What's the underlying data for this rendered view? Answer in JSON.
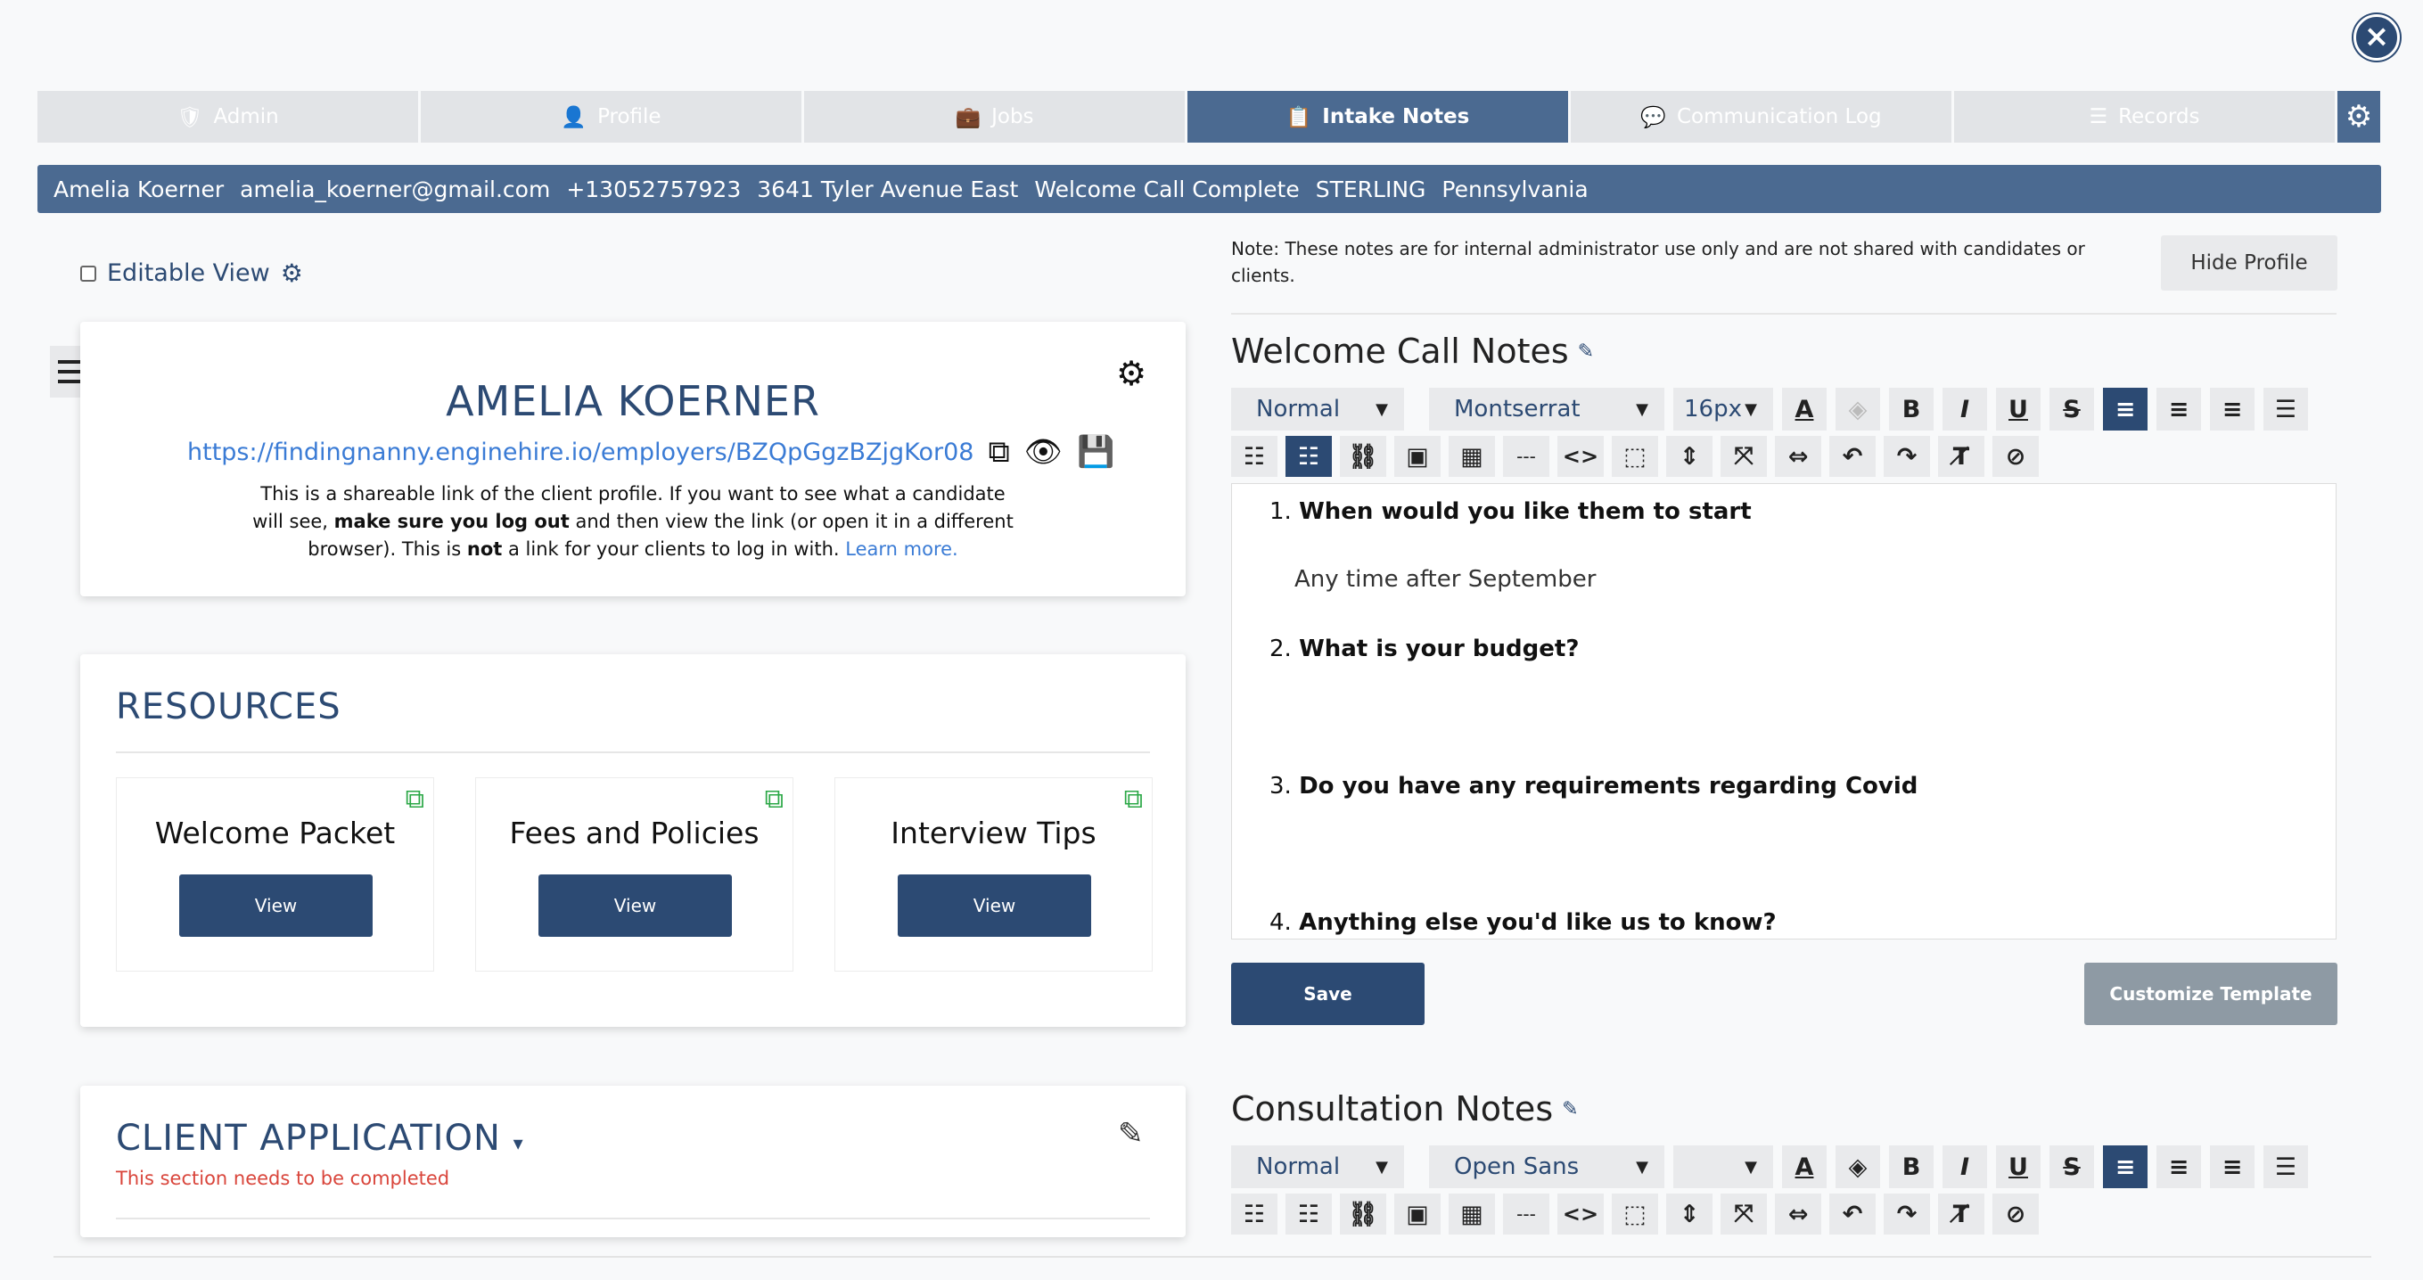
{
  "tabs": [
    {
      "label": "Admin",
      "icon": "user-shield-icon"
    },
    {
      "label": "Profile",
      "icon": "user-icon"
    },
    {
      "label": "Jobs",
      "icon": "briefcase-icon"
    },
    {
      "label": "Intake Notes",
      "icon": "clipboard-icon",
      "active": true
    },
    {
      "label": "Communication Log",
      "icon": "chat-icon"
    },
    {
      "label": "Records",
      "icon": "list-icon"
    }
  ],
  "info_bar": {
    "name": "Amelia Koerner",
    "email": "amelia_koerner@gmail.com",
    "phone": "+13052757923",
    "address": "3641 Tyler Avenue East",
    "status": "Welcome Call Complete",
    "tag": "STERLING",
    "state": "Pennsylvania"
  },
  "editable_view": {
    "label": "Editable View"
  },
  "profile": {
    "name": "AMELIA KOERNER",
    "link": "https://findingnanny.enginehire.io/employers/BZQpGgzBZjgKor08",
    "desc_1": "This is a shareable link of the client profile. If you want to see what a candidate will see, ",
    "desc_bold_1": "make sure you log out",
    "desc_2": " and then view the link (or open it in a different browser). This is ",
    "desc_bold_2": "not",
    "desc_3": " a link for your clients to log in with. ",
    "learn_more": "Learn more."
  },
  "resources": {
    "title": "RESOURCES",
    "items": [
      {
        "label": "Welcome Packet",
        "button": "View"
      },
      {
        "label": "Fees and Policies",
        "button": "View"
      },
      {
        "label": "Interview Tips",
        "button": "View"
      }
    ]
  },
  "client_application": {
    "title": "CLIENT APPLICATION",
    "warning": "This section needs to be completed"
  },
  "notes": {
    "disclaimer": "Note: These notes are for internal administrator use only and are not shared with candidates or clients.",
    "hide_profile": "Hide Profile"
  },
  "welcome_notes": {
    "title": "Welcome Call Notes",
    "style": "Normal",
    "font": "Montserrat",
    "size": "16px",
    "questions": [
      {
        "num": "1.",
        "text": "When would you like them to start",
        "answer": "Any time after September"
      },
      {
        "num": "2.",
        "text": "What is your budget?",
        "answer": ""
      },
      {
        "num": "3.",
        "text": "Do you have any requirements regarding Covid",
        "answer": ""
      },
      {
        "num": "4.",
        "text": "Anything else you'd like us to know?",
        "answer": ""
      }
    ],
    "save": "Save",
    "customize": "Customize Template"
  },
  "consultation_notes": {
    "title": "Consultation Notes",
    "style": "Normal",
    "font": "Open Sans",
    "size": ""
  },
  "toolbar_divider_label": "---",
  "toolbar_code_label": "<>",
  "colors": {
    "primary": "#2c4a73",
    "tab_bar": "#4b6a91",
    "tab_inactive": "#e2e4e7",
    "success": "#2aa745",
    "danger": "#d9453b"
  }
}
